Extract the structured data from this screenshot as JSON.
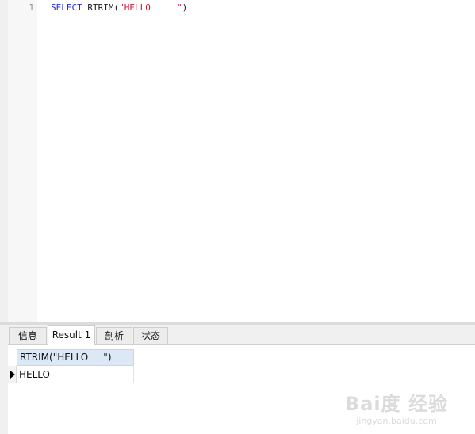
{
  "editor": {
    "line_number": "1",
    "keyword": "SELECT",
    "function": "RTRIM(",
    "string": "\"HELLO     \"",
    "close": ")"
  },
  "tabs": [
    {
      "label": "信息",
      "active": false
    },
    {
      "label": "Result 1",
      "active": true
    },
    {
      "label": "剖析",
      "active": false
    },
    {
      "label": "状态",
      "active": false
    }
  ],
  "result": {
    "column_header": "RTRIM(\"HELLO     \")",
    "rows": [
      [
        "HELLO"
      ]
    ]
  },
  "watermark": {
    "logo": "Bai度 经验",
    "url": "jingyan.baidu.com"
  }
}
